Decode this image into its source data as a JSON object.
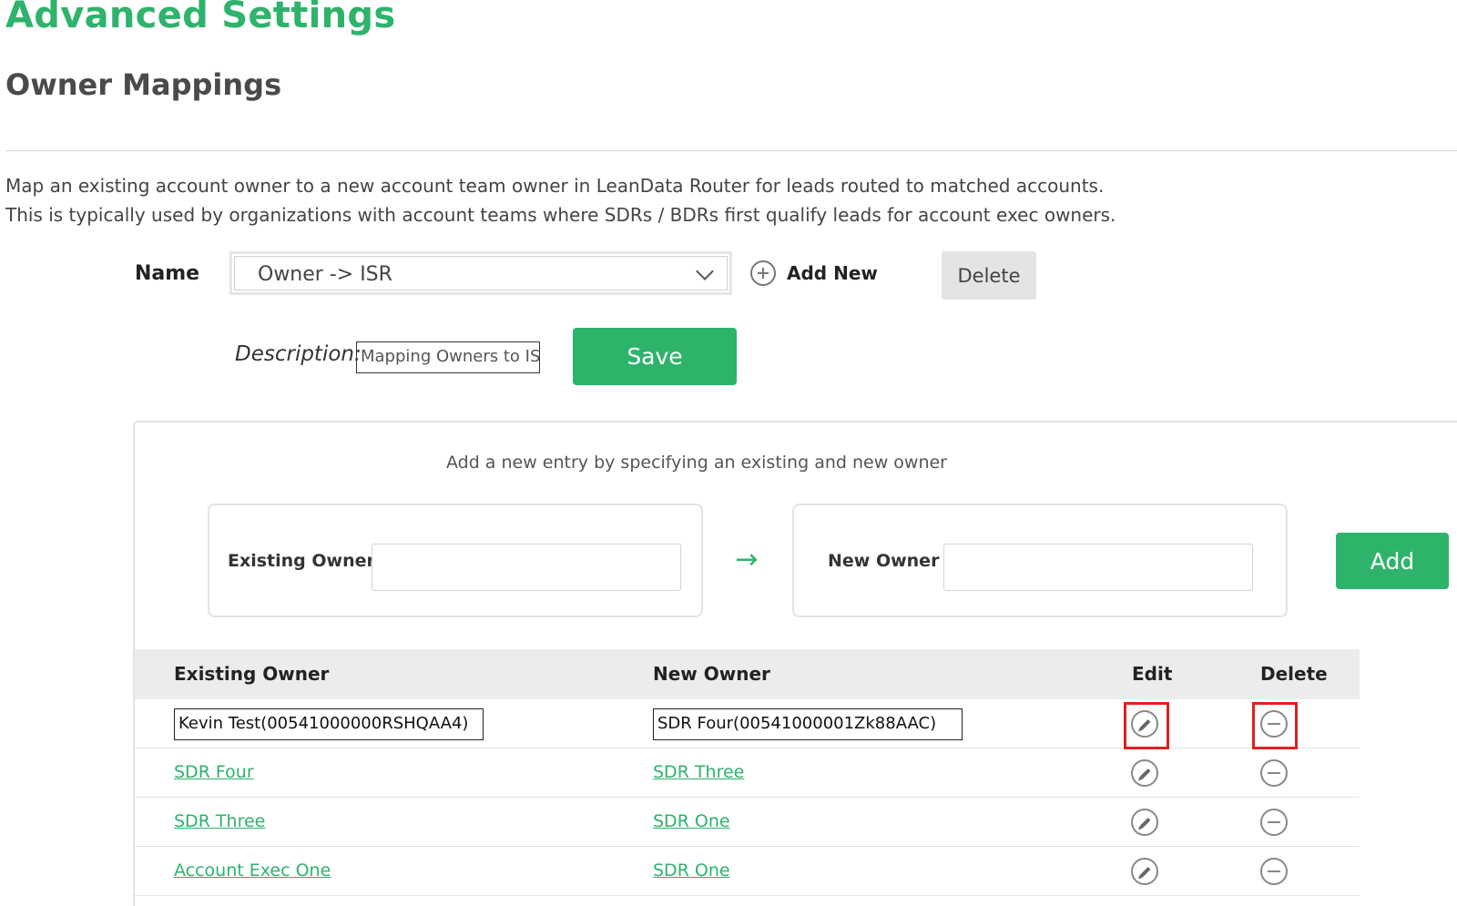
{
  "header": {
    "title": "Advanced Settings",
    "subtitle": "Owner Mappings"
  },
  "description_text": {
    "line1": "Map an existing account owner to a new account team owner in LeanData Router for leads routed to matched accounts.",
    "line2": "This is typically used by organizations with account teams where SDRs / BDRs first qualify leads for account exec owners."
  },
  "mapping_form": {
    "name_label": "Name",
    "name_value": "Owner -> ISR",
    "add_new_label": "Add New",
    "delete_label": "Delete",
    "description_label": "Description:",
    "description_value": "Mapping Owners to IS",
    "save_label": "Save"
  },
  "entry_panel": {
    "hint": "Add a new entry by specifying an existing and new owner",
    "existing_owner_label": "Existing Owner",
    "new_owner_label": "New Owner",
    "add_label": "Add"
  },
  "table": {
    "headers": {
      "existing_owner": "Existing Owner",
      "new_owner": "New Owner",
      "edit": "Edit",
      "delete": "Delete"
    },
    "editing_row": {
      "existing_owner": "Kevin Test(00541000000RSHQAA4)",
      "new_owner": "SDR Four(00541000001Zk88AAC)"
    },
    "rows": [
      {
        "existing_owner": "SDR Four",
        "new_owner": "SDR Three"
      },
      {
        "existing_owner": "SDR Three",
        "new_owner": "SDR One"
      },
      {
        "existing_owner": "Account Exec One",
        "new_owner": "SDR One"
      }
    ]
  },
  "colors": {
    "accent": "#2eb36b",
    "highlight": "#e02020"
  }
}
